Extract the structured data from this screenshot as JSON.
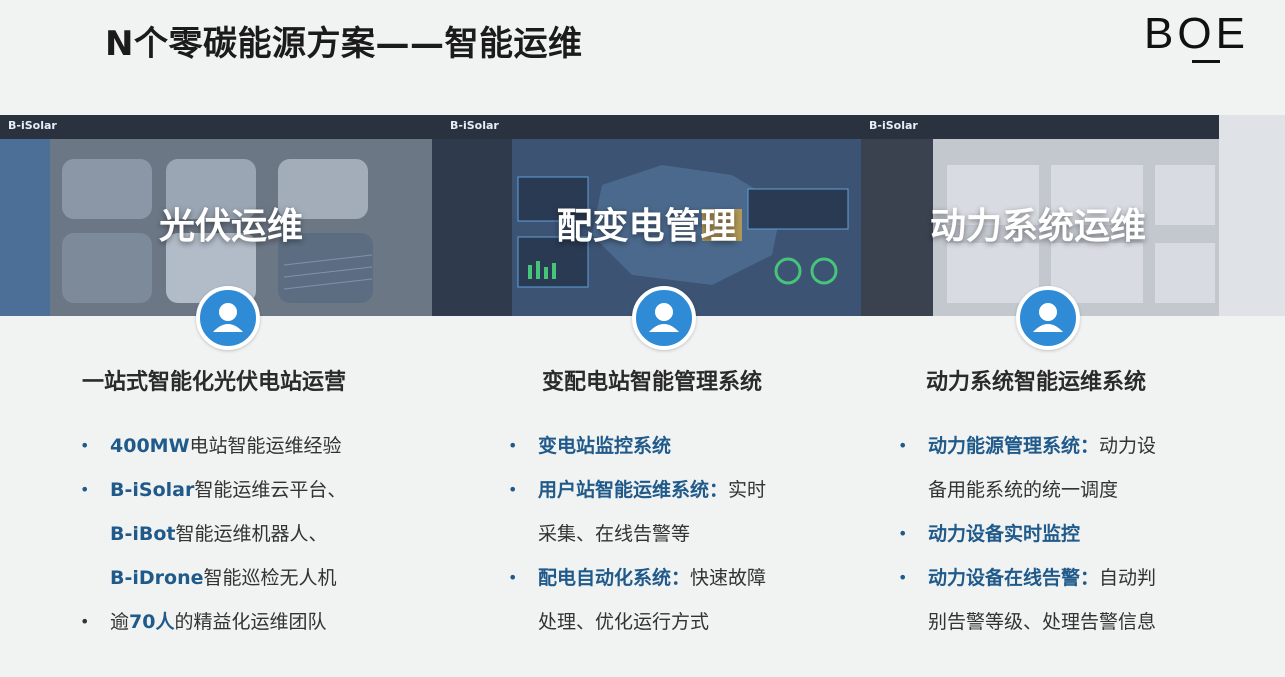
{
  "title": "N个零碳能源方案——智能运维",
  "logo": "BOE",
  "columns": [
    {
      "banner_label": "光伏运维",
      "screen_brand": "B-iSolar",
      "heading": "一站式智能化光伏电站运营",
      "items": [
        {
          "bold": "400MW",
          "text": "电站智能运维经验"
        },
        {
          "bold": "B-iSolar",
          "text": "智能运维云平台、"
        },
        {
          "bold": "B-iBot",
          "text": "智能运维机器人、"
        },
        {
          "bold": "B-iDrone",
          "text": "智能巡检无人机"
        },
        {
          "pre": "逾",
          "bold": "70人",
          "text": "的精益化运维团队"
        }
      ]
    },
    {
      "banner_label": "配变电管理",
      "screen_brand": "B-iSolar",
      "heading": "变配电站智能管理系统",
      "items": [
        {
          "bold": "变电站监控系统",
          "text": ""
        },
        {
          "bold": "用户站智能运维系统：",
          "text": "实时"
        },
        {
          "bold": "",
          "text": "采集、在线告警等"
        },
        {
          "bold": "配电自动化系统：",
          "text": "快速故障"
        },
        {
          "bold": "",
          "text": "处理、优化运行方式"
        }
      ]
    },
    {
      "banner_label": "动力系统运维",
      "screen_brand": "B-iSolar",
      "heading": "动力系统智能运维系统",
      "items": [
        {
          "bold": "动力能源管理系统：",
          "text": "动力设"
        },
        {
          "bold": "",
          "text": "备用能系统的统一调度"
        },
        {
          "bold": "动力设备实时监控",
          "text": ""
        },
        {
          "bold": "动力设备在线告警：",
          "text": "自动判"
        },
        {
          "bold": "",
          "text": "别告警等级、处理告警信息"
        }
      ]
    }
  ],
  "colors": {
    "accent": "#1f5a8a",
    "avatar": "#2f8bd6",
    "background": "#f1f2f2"
  }
}
